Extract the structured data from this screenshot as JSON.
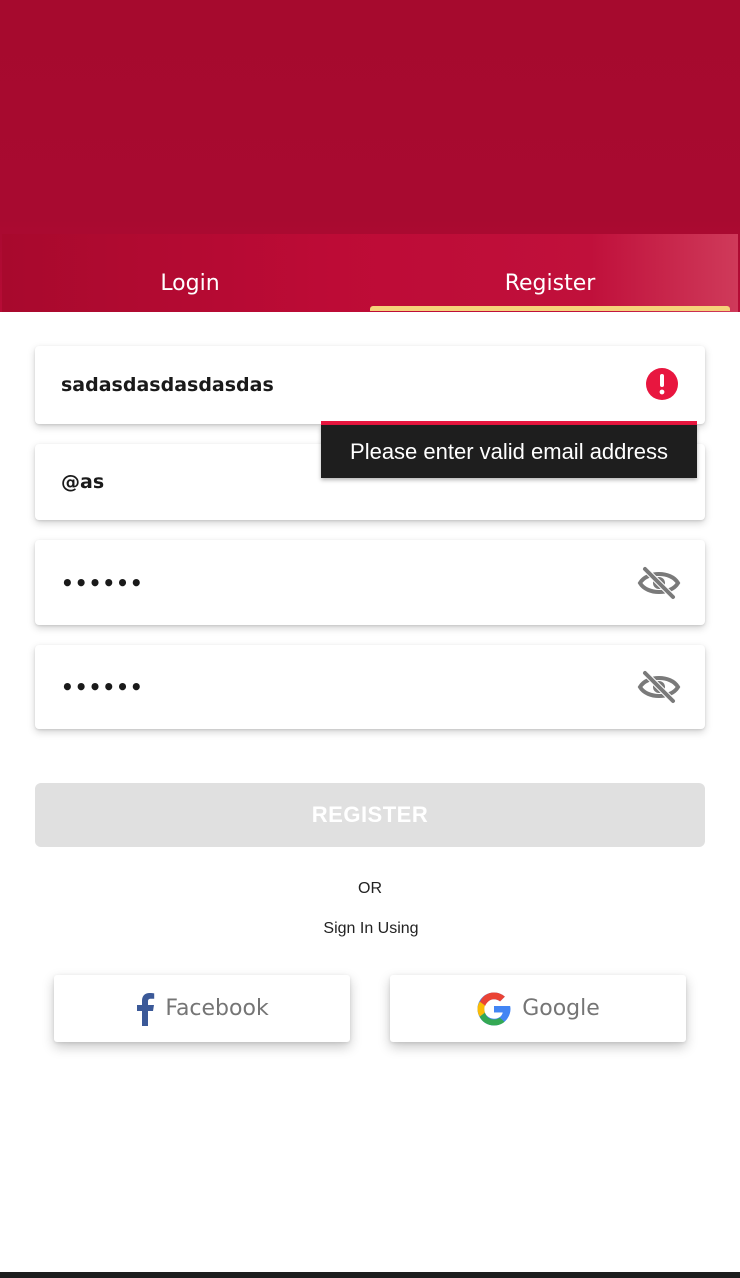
{
  "tabs": {
    "login_label": "Login",
    "register_label": "Register",
    "active": "Register"
  },
  "form": {
    "name_value": "sadasdasdasdasdas",
    "email_value": "@as",
    "password_value": "••••••",
    "confirm_password_value": "••••••",
    "error_tooltip": "Please enter valid email address",
    "register_label": "REGISTER"
  },
  "social": {
    "or_label": "OR",
    "sign_in_using_label": "Sign In Using",
    "facebook_label": "Facebook",
    "google_label": "Google"
  },
  "colors": {
    "header": "#a60a2e",
    "tab_indicator": "#f6d27a",
    "error": "#e8163f",
    "disabled_button": "#e0e0e0",
    "facebook": "#3b5998"
  },
  "icons": [
    "error-icon",
    "eye-off-icon",
    "facebook-icon",
    "google-icon"
  ]
}
